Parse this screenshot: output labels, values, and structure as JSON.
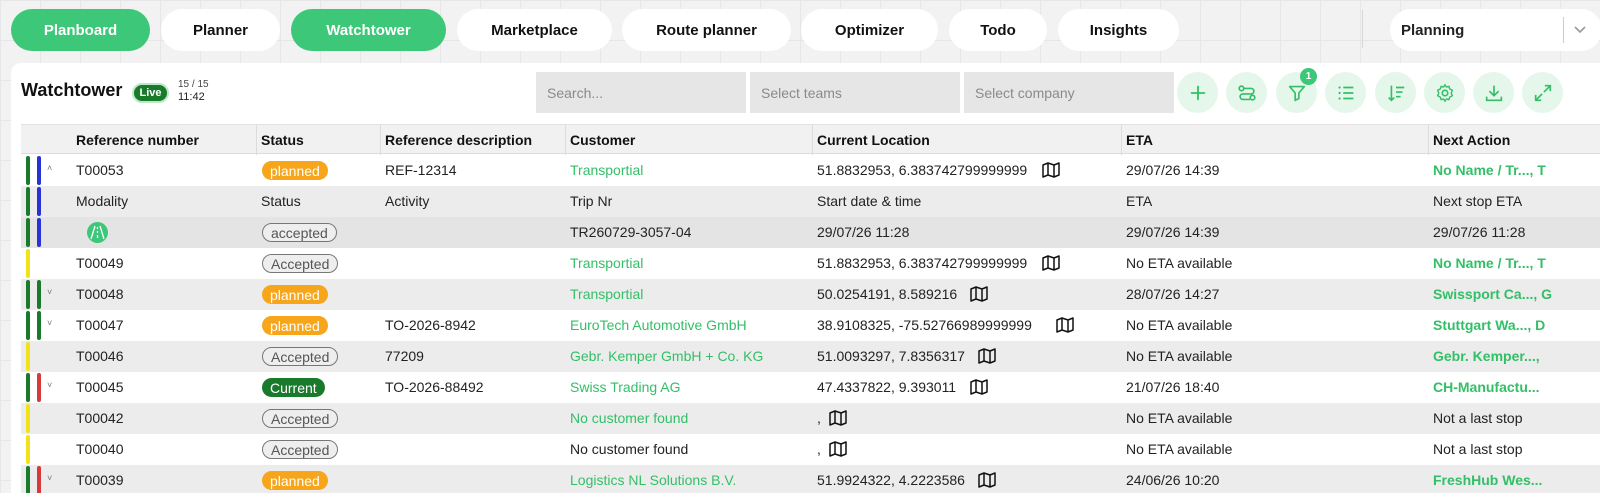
{
  "nav": {
    "tabs": [
      {
        "label": "Planboard",
        "active": true
      },
      {
        "label": "Planner",
        "active": false
      },
      {
        "label": "Watchtower",
        "active": true
      },
      {
        "label": "Marketplace",
        "active": false
      },
      {
        "label": "Route planner",
        "active": false
      },
      {
        "label": "Optimizer",
        "active": false
      },
      {
        "label": "Todo",
        "active": false
      },
      {
        "label": "Insights",
        "active": false
      }
    ],
    "select_value": "Planning"
  },
  "panel": {
    "title": "Watchtower",
    "live_label": "Live",
    "count": "15 / 15",
    "time": "11:42",
    "search_placeholder": "Search...",
    "teams_placeholder": "Select teams",
    "company_placeholder": "Select company",
    "filter_badge": "1",
    "icons": [
      "plus-icon",
      "route-icon",
      "filter-icon",
      "list-icon",
      "sort-icon",
      "gear-icon",
      "download-icon",
      "expand-icon"
    ]
  },
  "colors": {
    "accent": "#3cc878",
    "dark_green": "#1a7a2c",
    "orange": "#f7a51b",
    "yellow": "#f0e31a",
    "blue": "#2733d6",
    "red": "#d63a3a"
  },
  "table": {
    "headers": [
      "Reference number",
      "Status",
      "Reference description",
      "Customer",
      "Current Location",
      "ETA",
      "Next Action"
    ],
    "sub_headers": [
      "Modality",
      "Status",
      "Activity",
      "Trip Nr",
      "Start date & time",
      "ETA",
      "Next stop ETA"
    ],
    "sub_row": {
      "status": "accepted",
      "trip": "TR260729-3057-04",
      "start": "29/07/26 11:28",
      "eta": "29/07/26 14:39",
      "next_eta": "29/07/26 11:28"
    },
    "rows": [
      {
        "ref": "T00053",
        "status": "planned",
        "desc": "REF-12314",
        "customer": "Transportial",
        "location": "51.8832953, 6.383742799999999",
        "eta": "29/07/26 14:39",
        "next": "No Name / Tr..., T"
      },
      {
        "ref": "T00049",
        "status": "Accepted",
        "desc": "",
        "customer": "Transportial",
        "location": "51.8832953, 6.383742799999999",
        "eta": "No ETA available",
        "next": "No Name / Tr..., T"
      },
      {
        "ref": "T00048",
        "status": "planned",
        "desc": "",
        "customer": "Transportial",
        "location": "50.0254191, 8.589216",
        "eta": "28/07/26 14:27",
        "next": "Swissport Ca..., G"
      },
      {
        "ref": "T00047",
        "status": "planned",
        "desc": "TO-2026-8942",
        "customer": "EuroTech Automotive GmbH",
        "location": "38.9108325, -75.52766989999999",
        "eta": "No ETA available",
        "next": "Stuttgart Wa..., D"
      },
      {
        "ref": "T00046",
        "status": "Accepted",
        "desc": "77209",
        "customer": "Gebr. Kemper GmbH + Co. KG",
        "location": "51.0093297, 7.8356317",
        "eta": "No ETA available",
        "next": "Gebr. Kemper..., "
      },
      {
        "ref": "T00045",
        "status": "Current",
        "desc": "TO-2026-88492",
        "customer": "Swiss Trading AG",
        "location": "47.4337822, 9.393011",
        "eta": "21/07/26 18:40",
        "next": "CH-Manufactu..."
      },
      {
        "ref": "T00042",
        "status": "Accepted",
        "desc": "",
        "customer": "No customer found",
        "location": ",",
        "eta": "No ETA available",
        "next": "Not a last stop"
      },
      {
        "ref": "T00040",
        "status": "Accepted",
        "desc": "",
        "customer": "No customer found",
        "location": ",",
        "eta": "No ETA available",
        "next": "Not a last stop"
      },
      {
        "ref": "T00039",
        "status": "planned",
        "desc": "",
        "customer": "Logistics NL Solutions B.V.",
        "location": "51.9924322, 4.2223586",
        "eta": "24/06/26 10:20",
        "next": "FreshHub Wes..."
      }
    ]
  }
}
